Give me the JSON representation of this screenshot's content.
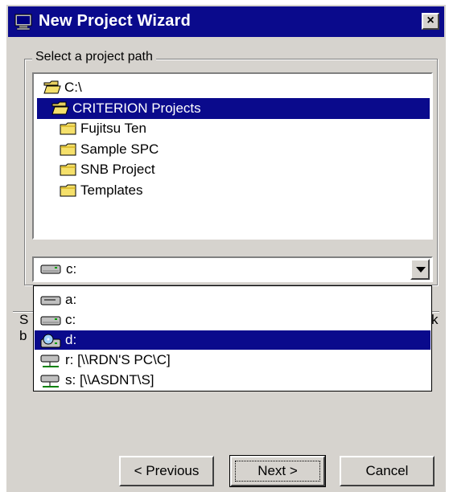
{
  "window": {
    "title": "New Project Wizard",
    "close_label": "×"
  },
  "group": {
    "label": "Select a project path"
  },
  "tree": [
    {
      "label": "C:\\",
      "icon": "open-folder-icon",
      "indent": 0,
      "selected": false
    },
    {
      "label": "CRITERION Projects",
      "icon": "open-folder-icon",
      "indent": 1,
      "selected": true
    },
    {
      "label": "Fujitsu Ten",
      "icon": "folder-icon",
      "indent": 2,
      "selected": false
    },
    {
      "label": "Sample SPC",
      "icon": "folder-icon",
      "indent": 2,
      "selected": false
    },
    {
      "label": "SNB Project",
      "icon": "folder-icon",
      "indent": 2,
      "selected": false
    },
    {
      "label": "Templates",
      "icon": "folder-icon",
      "indent": 2,
      "selected": false
    }
  ],
  "drive_combo": {
    "value": "c:"
  },
  "drive_list": [
    {
      "label": "a:",
      "icon": "floppy-drive-icon",
      "selected": false
    },
    {
      "label": "c:",
      "icon": "hard-drive-icon",
      "selected": false
    },
    {
      "label": "d:",
      "icon": "cd-drive-icon",
      "selected": true
    },
    {
      "label": "r: [\\\\RDN'S PC\\C]",
      "icon": "network-drive-icon",
      "selected": false
    },
    {
      "label": "s: [\\\\ASDNT\\S]",
      "icon": "network-drive-icon",
      "selected": false
    }
  ],
  "hidden_text": {
    "left1": "S",
    "left2": "b",
    "right1": "k"
  },
  "buttons": {
    "previous": "< Previous",
    "next": "Next >",
    "cancel": "Cancel"
  }
}
